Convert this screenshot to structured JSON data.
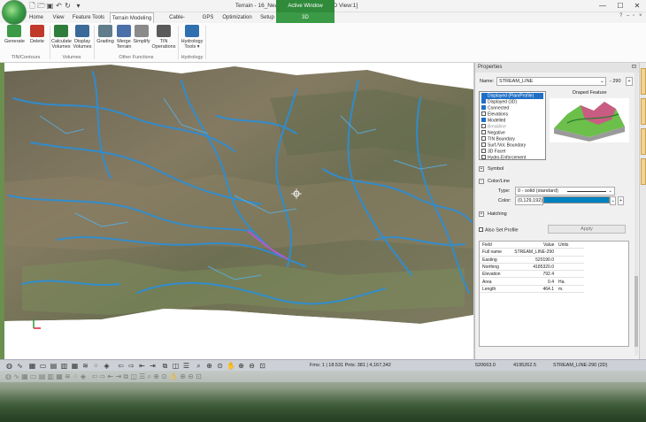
{
  "window": {
    "title": "Terrain - 16_Near Beckley WV.terx - [3D View:1]",
    "active_window_label": "Active Window",
    "minimize": "—",
    "maximize": "☐",
    "close": "✕"
  },
  "menu": {
    "tabs": [
      "Home",
      "View",
      "Feature Tools",
      "Terrain Modeling",
      "Cable-Analysis",
      "GPS",
      "Optimization",
      "Setup"
    ],
    "active_tab": "Terrain Modeling",
    "context_tab": "3D"
  },
  "ribbon": {
    "buttons": [
      {
        "label": "Generate",
        "label2": "",
        "icon": "generate-icon",
        "color": "#3a9a46"
      },
      {
        "label": "Delete",
        "label2": "",
        "icon": "delete-icon",
        "color": "#c0392b"
      },
      {
        "label": "Calculate",
        "label2": "Volumes",
        "icon": "calculate-volumes-icon",
        "color": "#2f7d3b"
      },
      {
        "label": "Display",
        "label2": "Volumes",
        "icon": "display-volumes-icon",
        "color": "#3b6a9a"
      },
      {
        "label": "Grading",
        "label2": "",
        "icon": "grading-icon",
        "color": "#607d8b"
      },
      {
        "label": "Merge",
        "label2": "Terrain",
        "icon": "merge-terrain-icon",
        "color": "#4b6fa8"
      },
      {
        "label": "Simplify",
        "label2": "",
        "icon": "simplify-icon",
        "color": "#8a8a8a"
      },
      {
        "label": "TIN",
        "label2": "Operations",
        "icon": "tin-operations-icon",
        "color": "#5a5a5a"
      },
      {
        "label": "Hydrology",
        "label2": "Tools ▾",
        "icon": "hydrology-tools-icon",
        "color": "#2f6fb0"
      }
    ],
    "groups": [
      "TIN/Contours",
      "Volumes",
      "Other Functions",
      "Hydrology"
    ]
  },
  "properties": {
    "title": "Properties",
    "name_label": "Name:",
    "name_value": "STREAM_LINE",
    "name_number": "290",
    "draped_feature_label": "Draped Feature",
    "checkboxes": [
      {
        "label": "Displayed (Plan/Profile)",
        "checked": true,
        "selected": true
      },
      {
        "label": "Displayed (3D)",
        "checked": true
      },
      {
        "label": "Connected",
        "checked": true
      },
      {
        "label": "Elevations",
        "checked": false
      },
      {
        "label": "Modelled",
        "checked": true
      },
      {
        "label": "Breakline",
        "checked": false,
        "dim": true
      },
      {
        "label": "Negative",
        "checked": false
      },
      {
        "label": "TIN Boundary",
        "checked": false
      },
      {
        "label": "Surf./Vol. Boundary",
        "checked": false
      },
      {
        "label": "3D Facet",
        "checked": false
      },
      {
        "label": "Hydro-Enforcement",
        "checked": false
      }
    ],
    "symbol_label": "Symbol",
    "colorline_label": "Color/Line",
    "type_label": "Type:",
    "type_value": "0 - solid (standard)",
    "color_label": "Color:",
    "color_value": "(0,129,192)",
    "color_hex": "#0081c0",
    "hatching_label": "Hatching",
    "also_set_profile_label": "Also Set Profile",
    "apply_label": "Apply",
    "table": {
      "headers": [
        "Field",
        "Value",
        "Units"
      ],
      "rows": [
        [
          "Full name",
          "STREAM_LINE-290",
          ""
        ],
        [
          "Easting",
          "520190.0",
          ""
        ],
        [
          "Northing",
          "4185320.0",
          ""
        ],
        [
          "Elevation",
          "792.4",
          ""
        ],
        [
          "Area",
          "0.4",
          "Ha."
        ],
        [
          "Length",
          "464.1",
          "m."
        ]
      ]
    }
  },
  "statusbar": {
    "tool_icons": [
      "globe-icon",
      "wave-icon",
      "box-icon",
      "folder-icon",
      "layers-icon",
      "grid-icon",
      "contour-icon",
      "dots-icon",
      "cube-icon",
      "arrow-left-icon",
      "arrow-right-icon",
      "arrow-back-icon",
      "arrow-forward-icon",
      "windows-icon",
      "split-icon",
      "stack-icon",
      "zoom-icon",
      "zoom-window-icon",
      "zoom-all-icon",
      "pan-icon",
      "zoom-in-icon",
      "zoom-out-icon",
      "zoom-fit-icon"
    ],
    "frame_info": "Fms: 1 | 18.531  Pnts: 381 | 4,167,342",
    "easting": "520663.0",
    "northing": "4195262.5",
    "feature": "STREAM_LINE-290 (2D)"
  }
}
